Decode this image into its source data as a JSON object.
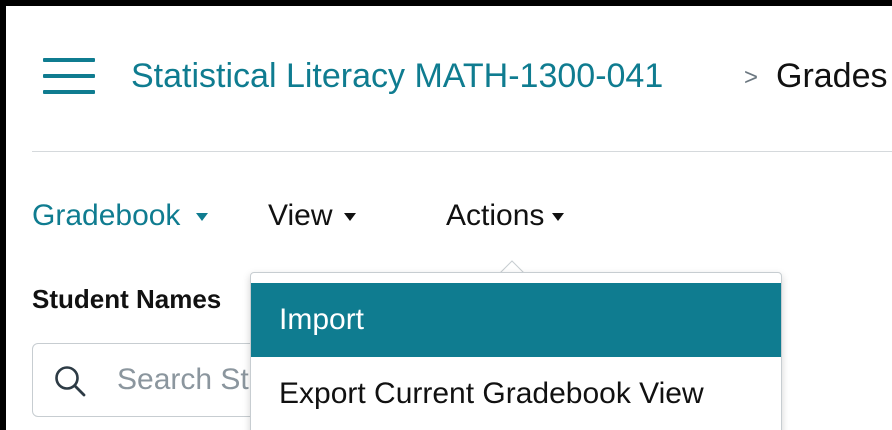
{
  "colors": {
    "brand": "#0f7c90",
    "highlight_bg": "#0f7c90",
    "text_dark": "#111111",
    "muted": "#8b969e"
  },
  "header": {
    "menu_icon": "hamburger-icon",
    "course_link": "Statistical Literacy MATH-1300-041",
    "separator": ">",
    "current_page": "Grades"
  },
  "toolbar": {
    "gradebook_label": "Gradebook",
    "view_label": "View",
    "actions_label": "Actions"
  },
  "student_filter": {
    "label": "Student Names",
    "search_icon": "search-icon",
    "placeholder": "Search Students",
    "value": ""
  },
  "actions_menu": {
    "items": [
      {
        "label": "Import",
        "highlighted": true
      },
      {
        "label": "Export Current Gradebook View",
        "highlighted": false
      }
    ]
  }
}
